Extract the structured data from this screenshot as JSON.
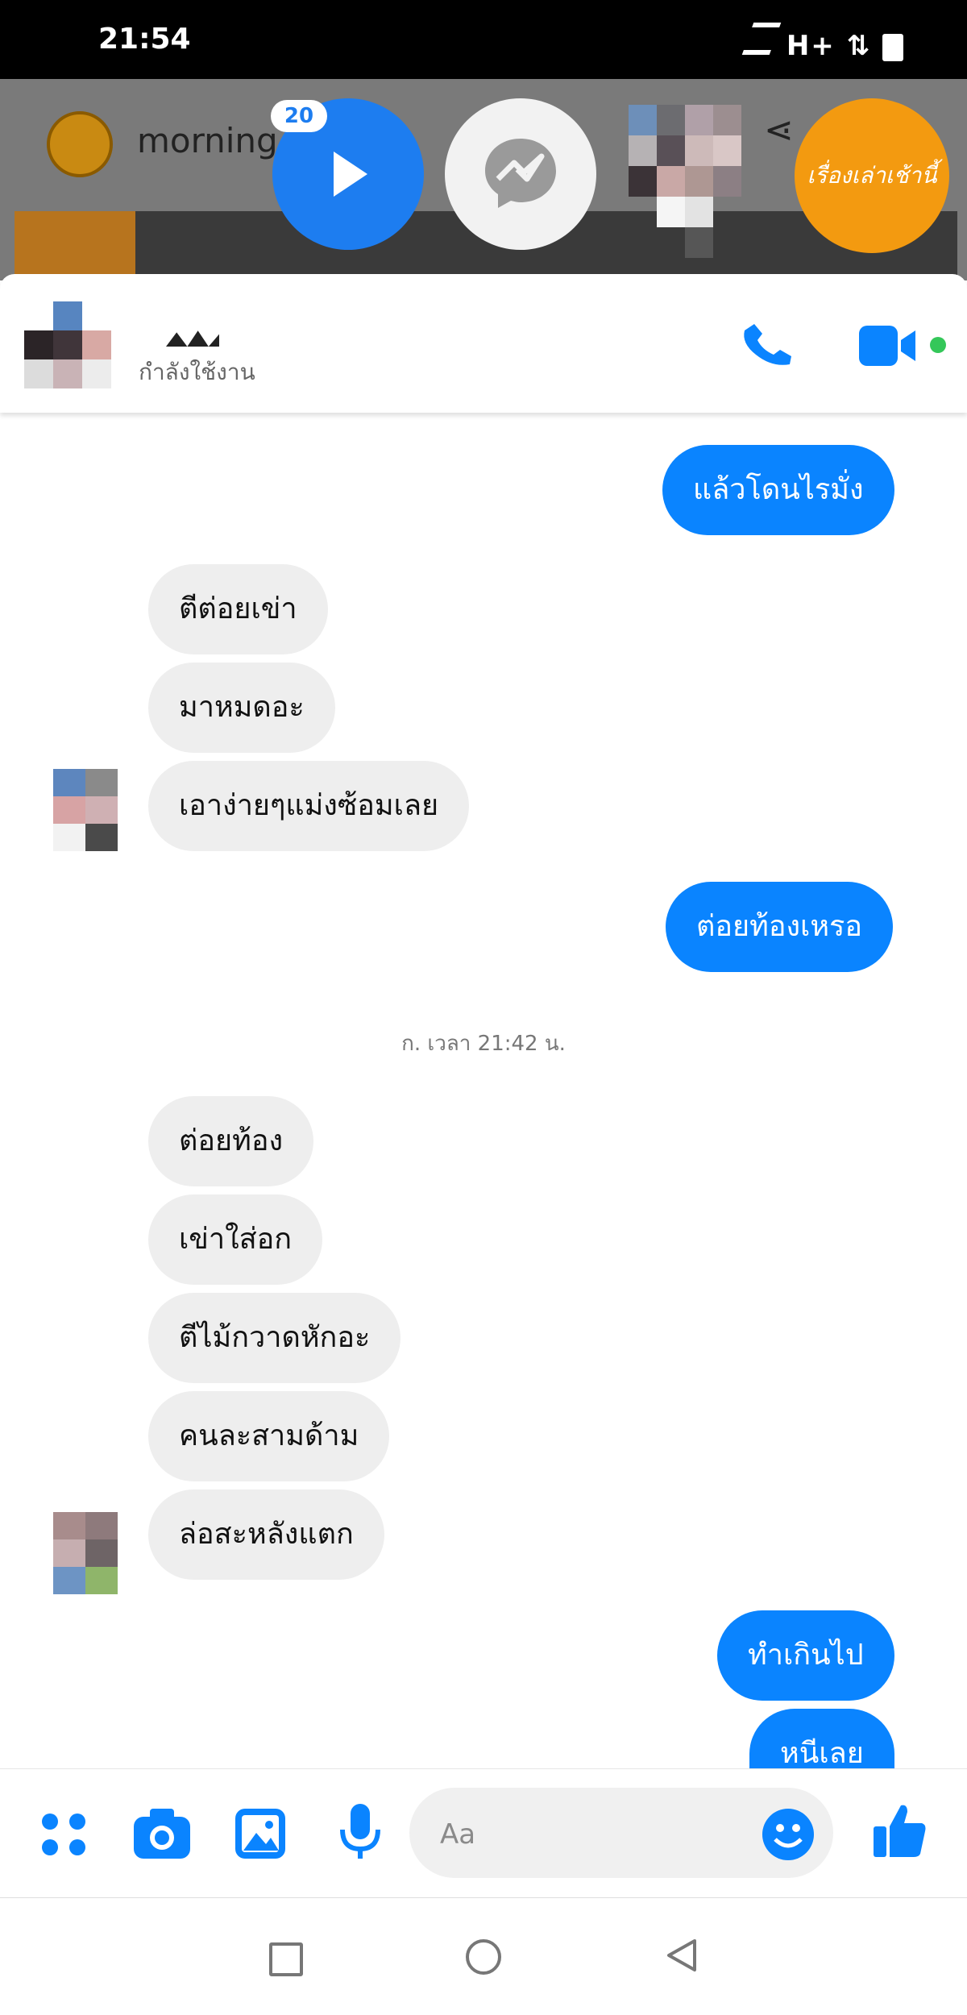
{
  "status_bar": {
    "time": "21:54",
    "signal": "H+"
  },
  "background_app": {
    "title": "morning"
  },
  "chat_heads": {
    "badge": "20",
    "orange_label": "เรื่องเล่าเช้านี้"
  },
  "chat_header": {
    "status": "กำลังใช้งาน"
  },
  "messages": [
    {
      "text": "แล้วโดนไรมั่ง"
    },
    {
      "text": "ตีต่อยเข่า"
    },
    {
      "text": "มาหมดอะ"
    },
    {
      "text": "เอาง่ายๆแม่งซ้อมเลย"
    },
    {
      "text": "ต่อยท้องเหรอ"
    },
    {
      "text": "ต่อยท้อง"
    },
    {
      "text": "เข่าใส่อก"
    },
    {
      "text": "ตีไม้กวาดหักอะ"
    },
    {
      "text": "คนละสามด้าม"
    },
    {
      "text": "ล่อสะหลังแตก"
    },
    {
      "text": "ทำเกินไป"
    },
    {
      "text": "หนีเลย"
    }
  ],
  "timestamp": "ก. เวลา 21:42 น.",
  "composer": {
    "placeholder": "Aa"
  },
  "colors": {
    "accent": "#0a84ff",
    "incoming_bubble": "#eeeeee"
  }
}
